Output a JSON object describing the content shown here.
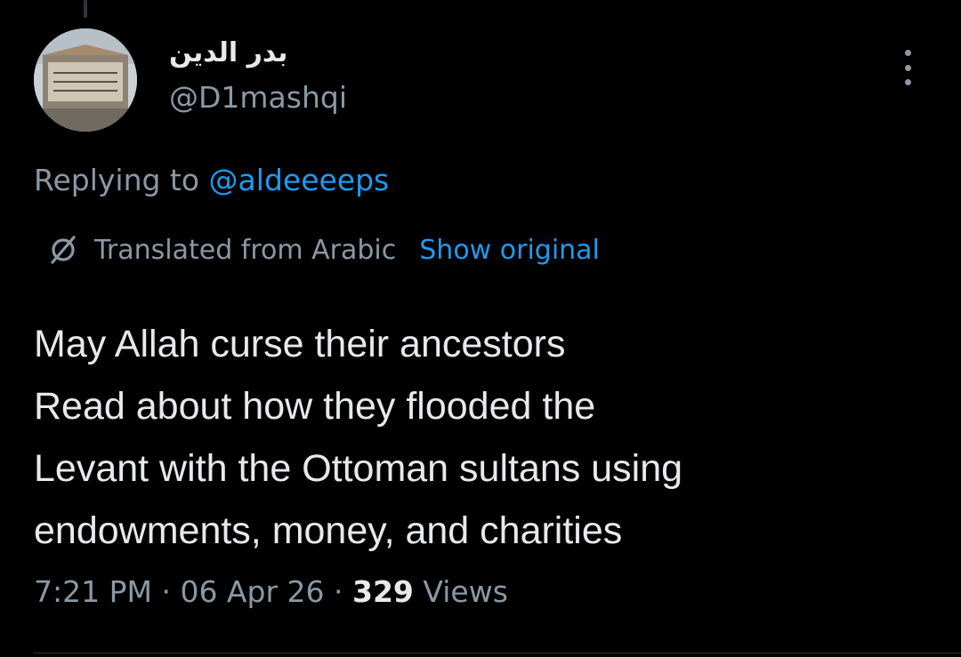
{
  "tweet": {
    "author": {
      "name": "بدر الدين",
      "handle": "@D1mashqi",
      "avatar": "avatar-photo"
    },
    "reply": {
      "prefix": "Replying to ",
      "to_handle": "@aldeeeeps"
    },
    "translation": {
      "icon": "translate-globe-slash-icon",
      "label": "Translated from Arabic",
      "show_original": "Show original"
    },
    "text_lines": [
      "May Allah curse their ancestors",
      "Read about how they flooded the",
      "Levant with the Ottoman sultans using",
      "endowments, money, and charities"
    ],
    "meta": {
      "time": "7:21 PM",
      "sep1": " · ",
      "date": "06 Apr 26",
      "sep2": " · ",
      "views_count": "329",
      "views_label": " Views"
    },
    "more_icon": "more-options-icon"
  },
  "colors": {
    "background": "#000000",
    "text_primary": "#e7e9ea",
    "text_secondary": "#8b98a5",
    "link": "#1d9bf0"
  }
}
